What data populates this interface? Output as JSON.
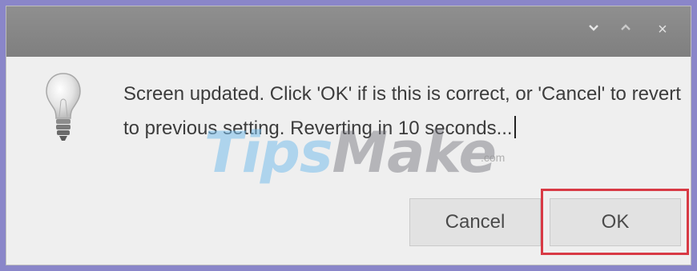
{
  "dialog": {
    "message": "Screen updated. Click 'OK' if is this is correct, or 'Cancel' to revert to previous setting. Reverting in 10 seconds...",
    "icon": "lightbulb-icon"
  },
  "titlebar": {
    "controls": [
      "minimize-icon",
      "maximize-icon",
      "close-icon"
    ],
    "close_glyph": "×"
  },
  "buttons": {
    "cancel_label": "Cancel",
    "ok_label": "OK"
  },
  "watermark": {
    "part1": "Tips",
    "part2": "Make",
    "suffix": ".com"
  },
  "colors": {
    "titlebar": "#878787",
    "dialog_background": "#efefef",
    "button": "#e2e2e2",
    "highlight": "#d83a45",
    "outer_border": "#8a86c9"
  }
}
